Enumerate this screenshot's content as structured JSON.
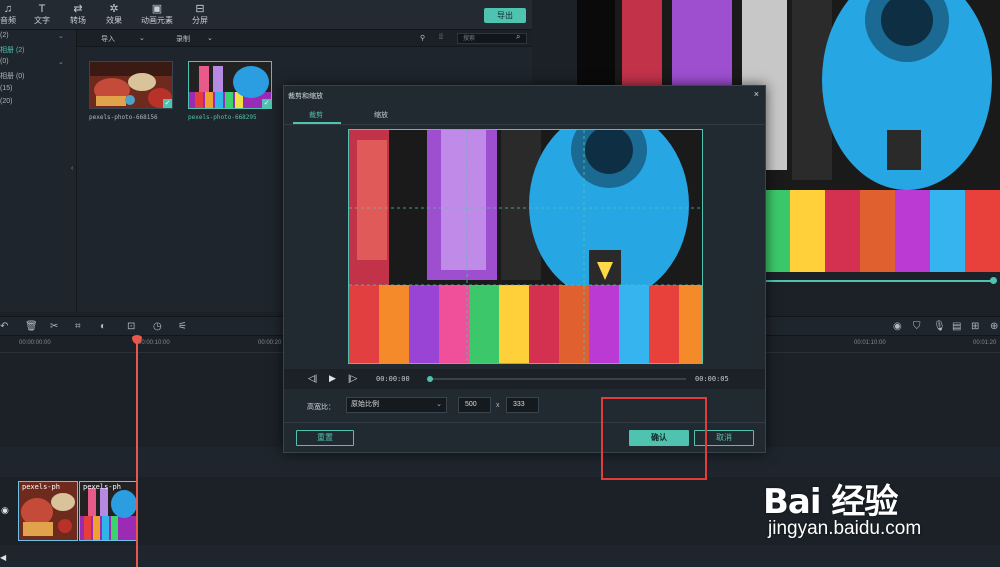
{
  "toolbar": {
    "tools": [
      {
        "label": "音频",
        "icon": "music-note-icon"
      },
      {
        "label": "文字",
        "icon": "text-icon"
      },
      {
        "label": "转场",
        "icon": "transition-icon"
      },
      {
        "label": "效果",
        "icon": "effects-icon"
      },
      {
        "label": "动画元素",
        "icon": "image-icon"
      },
      {
        "label": "分屏",
        "icon": "split-screen-icon"
      }
    ],
    "export_label": "导出"
  },
  "sidebar": {
    "items": [
      {
        "label": "(2)"
      },
      {
        "label": "相册 (2)",
        "active": true
      },
      {
        "label": "(0)"
      },
      {
        "label": "相册 (0)"
      },
      {
        "label": "(15)"
      },
      {
        "label": "(20)"
      }
    ]
  },
  "media": {
    "import_label": "导入",
    "record_label": "录制",
    "search_placeholder": "搜索",
    "items": [
      {
        "name": "pexels-photo-668156"
      },
      {
        "name": "pexels-photo-668295"
      }
    ]
  },
  "timeline": {
    "ruler_labels": [
      "00:00:00:00",
      "00:00:10:00",
      "00:00:20",
      "00:01:10:00",
      "00:01:20"
    ],
    "clips": [
      {
        "label": "pexels-ph"
      },
      {
        "label": "pexels-ph"
      }
    ]
  },
  "dialog": {
    "title": "裁剪和缩放",
    "close": "×",
    "tabs": [
      {
        "label": "裁剪",
        "active": true
      },
      {
        "label": "缩放"
      }
    ],
    "time_current": "00:00:00",
    "time_total": "00:00:05",
    "aspect_label": "高宽比：",
    "aspect_value": "原始比例",
    "width": "500",
    "x": "x",
    "height": "333",
    "reset_label": "重置",
    "confirm_label": "确认",
    "cancel_label": "取消"
  },
  "watermark": {
    "logo": "Bai 经验",
    "url": "jingyan.baidu.com"
  },
  "colors": {
    "accent": "#4fc3b0",
    "playhead": "#e8584c",
    "highlight": "#e23c3c"
  }
}
